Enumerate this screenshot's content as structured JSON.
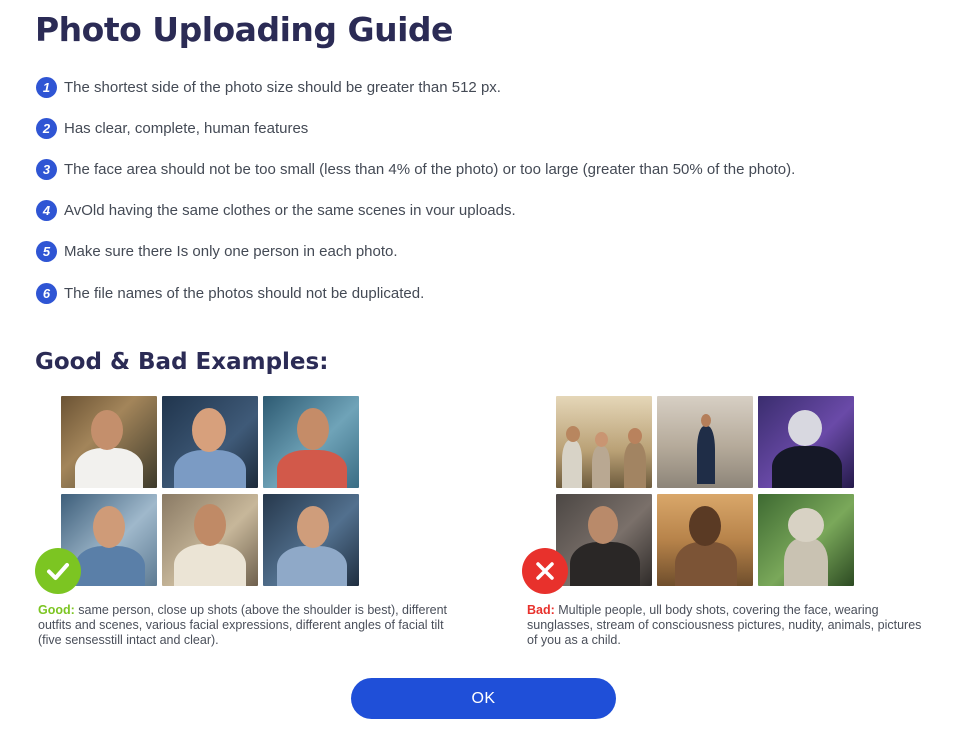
{
  "title": "Photo Uploading Guide",
  "rules": [
    {
      "num": "1",
      "text": "The shortest side of the photo size should be greater than 512 px."
    },
    {
      "num": "2",
      "text": "Has clear, complete, human features"
    },
    {
      "num": "3",
      "text": "The face area should not be too small (less than 4% of the photo) or too large (greater than 50% of the photo)."
    },
    {
      "num": "4",
      "text": "AvOld having the same clothes or the same scenes in vour uploads."
    },
    {
      "num": "5",
      "text": "Make sure there Is only one person in each photo."
    },
    {
      "num": "6",
      "text": "The file names of the photos should not be duplicated."
    }
  ],
  "examples_heading": "Good & Bad Examples:",
  "good": {
    "label": "Good:",
    "text": " same person, close up shots (above the shoulder is best), different outfits and scenes, various facial expressions, different angles of facial tilt (five sensesstill intact and clear).",
    "badge_icon": "check-icon",
    "color": "#7cc522"
  },
  "bad": {
    "label": "Bad:",
    "text": " Multiple people, ull body shots, covering the face, wearing sunglasses, stream of consciousness pictures, nudity, animals, pictures of you as a child.",
    "badge_icon": "x-icon",
    "color": "#e8312c"
  },
  "ok_button": "OK"
}
